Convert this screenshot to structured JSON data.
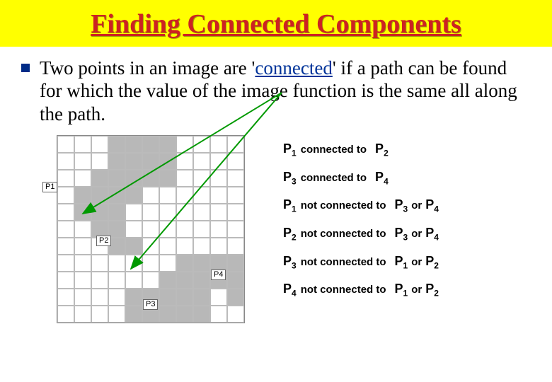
{
  "title": "Finding Connected Components",
  "bullet_text_a": "Two points in an image are '",
  "bullet_text_link": "connected",
  "bullet_text_b": "' if a path can be found for which the value of the image function is the same all along the path.",
  "labels": {
    "p1": "P1",
    "p2": "P2",
    "p3": "P3",
    "p4": "P4"
  },
  "conn": {
    "r1": {
      "a": "P",
      "as": "1",
      "m": "connected to",
      "b": "P",
      "bs": "2"
    },
    "r2": {
      "a": "P",
      "as": "3",
      "m": "connected to",
      "b": "P",
      "bs": "4"
    },
    "r3": {
      "a": "P",
      "as": "1",
      "m": "not connected to",
      "b": "P",
      "bs": "3",
      "o": "or",
      "c": "P",
      "cs": "4"
    },
    "r4": {
      "a": "P",
      "as": "2",
      "m": "not connected to",
      "b": "P",
      "bs": "3",
      "o": "or",
      "c": "P",
      "cs": "4"
    },
    "r5": {
      "a": "P",
      "as": "3",
      "m": "not connected to",
      "b": "P",
      "bs": "1",
      "o": "or",
      "c": "P",
      "cs": "2"
    },
    "r6": {
      "a": "P",
      "as": "4",
      "m": "not connected to",
      "b": "P",
      "bs": "1",
      "o": "or",
      "c": "P",
      "cs": "2"
    }
  },
  "grid": {
    "rows": 11,
    "cols": 11,
    "filled": [
      [
        0,
        3
      ],
      [
        0,
        4
      ],
      [
        0,
        5
      ],
      [
        0,
        6
      ],
      [
        1,
        3
      ],
      [
        1,
        4
      ],
      [
        1,
        5
      ],
      [
        1,
        6
      ],
      [
        2,
        2
      ],
      [
        2,
        3
      ],
      [
        2,
        4
      ],
      [
        2,
        5
      ],
      [
        2,
        6
      ],
      [
        3,
        1
      ],
      [
        3,
        2
      ],
      [
        3,
        3
      ],
      [
        3,
        4
      ],
      [
        4,
        1
      ],
      [
        4,
        2
      ],
      [
        4,
        3
      ],
      [
        5,
        2
      ],
      [
        5,
        3
      ],
      [
        6,
        3
      ],
      [
        6,
        4
      ],
      [
        7,
        7
      ],
      [
        7,
        8
      ],
      [
        7,
        9
      ],
      [
        7,
        10
      ],
      [
        8,
        6
      ],
      [
        8,
        7
      ],
      [
        8,
        8
      ],
      [
        8,
        9
      ],
      [
        8,
        10
      ],
      [
        9,
        4
      ],
      [
        9,
        5
      ],
      [
        9,
        6
      ],
      [
        9,
        7
      ],
      [
        9,
        8
      ],
      [
        9,
        10
      ],
      [
        10,
        4
      ],
      [
        10,
        5
      ],
      [
        10,
        6
      ],
      [
        10,
        7
      ],
      [
        10,
        8
      ]
    ]
  }
}
